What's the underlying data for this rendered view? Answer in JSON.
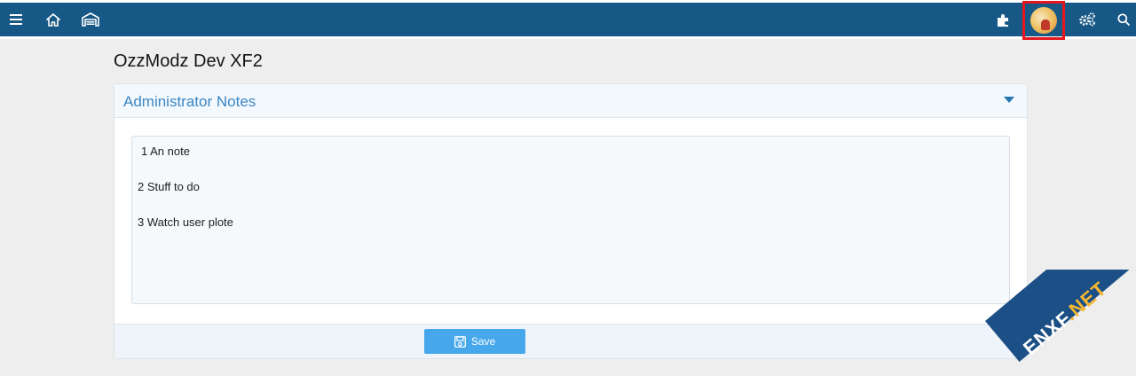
{
  "nav": {
    "icons": [
      "menu-icon",
      "home-icon",
      "garage-icon",
      "puzzle-icon",
      "avatar",
      "cogs-icon",
      "search-icon"
    ],
    "brand_color": "#185886"
  },
  "page": {
    "title": "OzzModz Dev XF2"
  },
  "notes_block": {
    "title": "Administrator Notes",
    "lines": [
      "1 An note",
      "2 Stuff to do",
      "3 Watch user plote"
    ],
    "save_label": "Save",
    "accent_color": "#47a7eb"
  },
  "watermark": {
    "main": "ENXF",
    "accent": ".NET"
  }
}
